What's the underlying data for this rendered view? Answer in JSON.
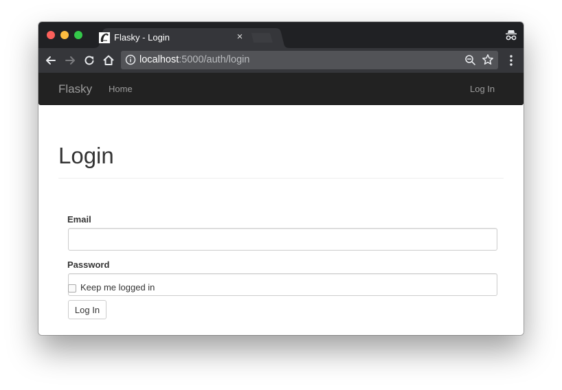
{
  "browser": {
    "tab": {
      "title": "Flasky - Login",
      "close_glyph": "×",
      "favicon": "flask-horn-favicon-icon"
    },
    "address_bar": {
      "host": "localhost",
      "path": ":5000/auth/login"
    },
    "toolbar_icons": [
      "back-arrow-icon",
      "forward-arrow-icon",
      "reload-icon",
      "home-icon",
      "info-icon",
      "zoom-out-icon",
      "bookmark-star-icon",
      "more-menu-icon"
    ],
    "window_icons": [
      "close-window-icon",
      "minimize-window-icon",
      "maximize-window-icon",
      "incognito-icon"
    ]
  },
  "navbar": {
    "brand": "Flasky",
    "links": [
      "Home"
    ],
    "right_link": "Log In"
  },
  "form": {
    "heading": "Login",
    "email_label": "Email",
    "email_value": "",
    "password_label": "Password",
    "password_value": "",
    "remember_label": "Keep me logged in",
    "remember_checked": false,
    "submit_label": "Log In"
  },
  "colors": {
    "navbar_bg": "#222222",
    "navbar_text": "#9d9d9d",
    "tabstrip_bg": "#202124",
    "toolbar_bg": "#35363a"
  }
}
